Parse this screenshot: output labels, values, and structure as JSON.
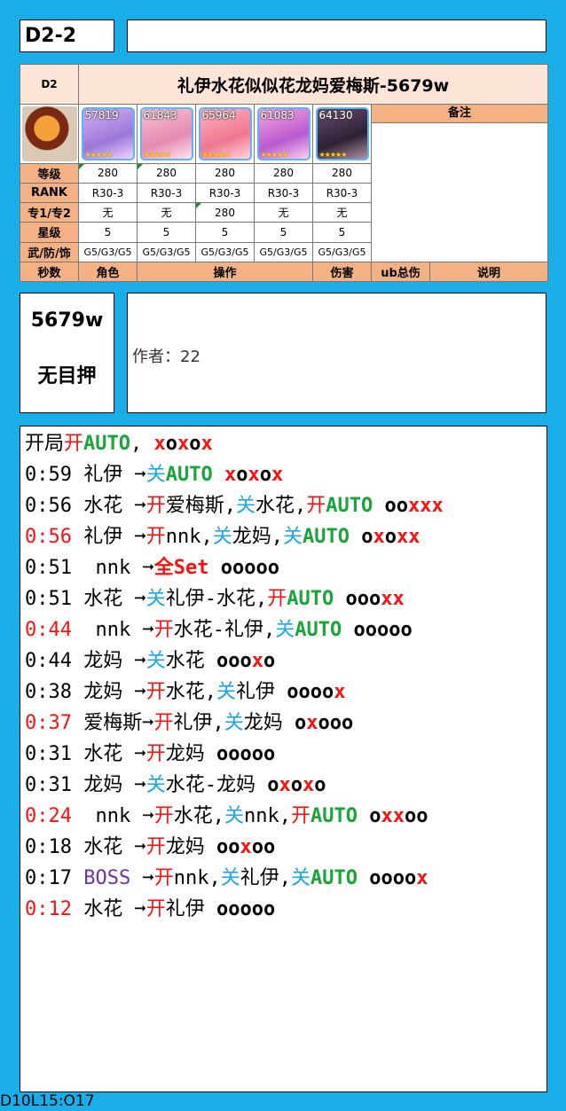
{
  "id_label": "D2-2",
  "table": {
    "stage": "D2",
    "title": "礼伊水花似似花龙妈爱梅斯-5679w",
    "notes_header": "备注",
    "characters": [
      {
        "number": "57819",
        "stars": "★★★★★"
      },
      {
        "number": "61843",
        "stars": "★★★★★"
      },
      {
        "number": "65964",
        "stars": "★★★★★"
      },
      {
        "number": "61083",
        "stars": "★★★★★"
      },
      {
        "number": "64130",
        "stars": "★★★★★"
      }
    ],
    "rows": [
      {
        "label": "等级",
        "values": [
          "280",
          "280",
          "280",
          "280",
          "280"
        ]
      },
      {
        "label": "RANK",
        "values": [
          "R30-3",
          "R30-3",
          "R30-3",
          "R30-3",
          "R30-3"
        ]
      },
      {
        "label": "专1/专2",
        "values": [
          "无",
          "无",
          "280",
          "无",
          "无"
        ]
      },
      {
        "label": "星级",
        "values": [
          "5",
          "5",
          "5",
          "5",
          "5"
        ]
      },
      {
        "label": "武/防/饰",
        "values": [
          "G5/G3/G5",
          "G5/G3/G5",
          "G5/G3/G5",
          "G5/G3/G5",
          "G5/G3/G5"
        ]
      }
    ],
    "footer_headers": {
      "seconds": "秒数",
      "role": "角色",
      "action": "操作",
      "damage": "伤害",
      "ub_total": "ub总伤",
      "description": "说明"
    }
  },
  "summary": {
    "damage": "5679w",
    "target": "无目押"
  },
  "note": {
    "author": "作者：22"
  },
  "timeline": [
    [
      {
        "t": "开局",
        "c": ""
      },
      {
        "t": "开",
        "c": "red"
      },
      {
        "t": "AUTO",
        "c": "green"
      },
      {
        "t": ", ",
        "c": ""
      },
      {
        "m": "xoxox"
      }
    ],
    [
      {
        "t": "0:59 礼伊 ",
        "c": ""
      },
      {
        "t": "➞",
        "c": "bold"
      },
      {
        "t": "关",
        "c": "blue"
      },
      {
        "t": "AUTO",
        "c": "green"
      },
      {
        "t": " ",
        "c": ""
      },
      {
        "m": "xoxox"
      }
    ],
    [
      {
        "t": "0:56 水花 ",
        "c": ""
      },
      {
        "t": "➞",
        "c": "bold"
      },
      {
        "t": "开",
        "c": "red"
      },
      {
        "t": "爱梅斯,",
        "c": ""
      },
      {
        "t": "关",
        "c": "blue"
      },
      {
        "t": "水花,",
        "c": ""
      },
      {
        "t": "开",
        "c": "red"
      },
      {
        "t": "AUTO",
        "c": "green"
      },
      {
        "t": " ",
        "c": ""
      },
      {
        "m": "ooxxx"
      }
    ],
    [
      {
        "t": "0:56",
        "c": "red"
      },
      {
        "t": " 礼伊 ",
        "c": ""
      },
      {
        "t": "➞",
        "c": "bold"
      },
      {
        "t": "开",
        "c": "red"
      },
      {
        "t": "nnk,",
        "c": ""
      },
      {
        "t": "关",
        "c": "blue"
      },
      {
        "t": "龙妈,",
        "c": ""
      },
      {
        "t": "关",
        "c": "blue"
      },
      {
        "t": "AUTO",
        "c": "green"
      },
      {
        "t": " ",
        "c": ""
      },
      {
        "m": "oxoxx"
      }
    ],
    [
      {
        "t": "0:51  nnk ",
        "c": ""
      },
      {
        "t": "➞",
        "c": "bold"
      },
      {
        "t": "全Set",
        "c": "red bold"
      },
      {
        "t": " ",
        "c": ""
      },
      {
        "m": "ooooo"
      }
    ],
    [
      {
        "t": "0:51 水花 ",
        "c": ""
      },
      {
        "t": "➞",
        "c": "bold"
      },
      {
        "t": "关",
        "c": "blue"
      },
      {
        "t": "礼伊-水花,",
        "c": ""
      },
      {
        "t": "开",
        "c": "red"
      },
      {
        "t": "AUTO",
        "c": "green"
      },
      {
        "t": " ",
        "c": ""
      },
      {
        "m": "oooxx"
      }
    ],
    [
      {
        "t": "0:44",
        "c": "red"
      },
      {
        "t": "  nnk ",
        "c": ""
      },
      {
        "t": "➞",
        "c": "bold"
      },
      {
        "t": "开",
        "c": "red"
      },
      {
        "t": "水花-礼伊,",
        "c": ""
      },
      {
        "t": "关",
        "c": "blue"
      },
      {
        "t": "AUTO",
        "c": "green"
      },
      {
        "t": " ",
        "c": ""
      },
      {
        "m": "ooooo"
      }
    ],
    [
      {
        "t": "0:44 龙妈 ",
        "c": ""
      },
      {
        "t": "➞",
        "c": "bold"
      },
      {
        "t": "关",
        "c": "blue"
      },
      {
        "t": "水花 ",
        "c": ""
      },
      {
        "m": "oooxo"
      }
    ],
    [
      {
        "t": "0:38 龙妈 ",
        "c": ""
      },
      {
        "t": "➞",
        "c": "bold"
      },
      {
        "t": "开",
        "c": "red"
      },
      {
        "t": "水花,",
        "c": ""
      },
      {
        "t": "关",
        "c": "blue"
      },
      {
        "t": "礼伊 ",
        "c": ""
      },
      {
        "m": "oooox"
      }
    ],
    [
      {
        "t": "0:37",
        "c": "red"
      },
      {
        "t": " 爱梅斯",
        "c": ""
      },
      {
        "t": "➞",
        "c": "bold"
      },
      {
        "t": "开",
        "c": "red"
      },
      {
        "t": "礼伊,",
        "c": ""
      },
      {
        "t": "关",
        "c": "blue"
      },
      {
        "t": "龙妈 ",
        "c": ""
      },
      {
        "m": "oxooo"
      }
    ],
    [
      {
        "t": "0:31 水花 ",
        "c": ""
      },
      {
        "t": "➞",
        "c": "bold"
      },
      {
        "t": "开",
        "c": "red"
      },
      {
        "t": "龙妈 ",
        "c": ""
      },
      {
        "m": "ooooo"
      }
    ],
    [
      {
        "t": "0:31 龙妈 ",
        "c": ""
      },
      {
        "t": "➞",
        "c": "bold"
      },
      {
        "t": "关",
        "c": "blue"
      },
      {
        "t": "水花-龙妈 ",
        "c": ""
      },
      {
        "m": "oxoxo"
      }
    ],
    [
      {
        "t": "0:24",
        "c": "red"
      },
      {
        "t": "  nnk ",
        "c": ""
      },
      {
        "t": "➞",
        "c": "bold"
      },
      {
        "t": "开",
        "c": "red"
      },
      {
        "t": "水花,",
        "c": ""
      },
      {
        "t": "关",
        "c": "blue"
      },
      {
        "t": "nnk,",
        "c": ""
      },
      {
        "t": "开",
        "c": "red"
      },
      {
        "t": "AUTO",
        "c": "green"
      },
      {
        "t": " ",
        "c": ""
      },
      {
        "m": "oxxoo"
      }
    ],
    [
      {
        "t": "0:18 水花 ",
        "c": ""
      },
      {
        "t": "➞",
        "c": "bold"
      },
      {
        "t": "开",
        "c": "red"
      },
      {
        "t": "龙妈 ",
        "c": ""
      },
      {
        "m": "ooxoo"
      }
    ],
    [
      {
        "t": "0:17 ",
        "c": ""
      },
      {
        "t": "BOSS",
        "c": "purple"
      },
      {
        "t": " ",
        "c": ""
      },
      {
        "t": "➞",
        "c": "bold"
      },
      {
        "t": "开",
        "c": "red"
      },
      {
        "t": "nnk,",
        "c": ""
      },
      {
        "t": "关",
        "c": "blue"
      },
      {
        "t": "礼伊,",
        "c": ""
      },
      {
        "t": "关",
        "c": "blue"
      },
      {
        "t": "AUTO",
        "c": "green"
      },
      {
        "t": " ",
        "c": ""
      },
      {
        "m": "oooox"
      }
    ],
    [
      {
        "t": "0:12",
        "c": "red"
      },
      {
        "t": " 水花 ",
        "c": ""
      },
      {
        "t": "➞",
        "c": "bold"
      },
      {
        "t": "开",
        "c": "red"
      },
      {
        "t": "礼伊 ",
        "c": ""
      },
      {
        "m": "ooooo"
      }
    ]
  ],
  "footer": "D10L15:O17"
}
